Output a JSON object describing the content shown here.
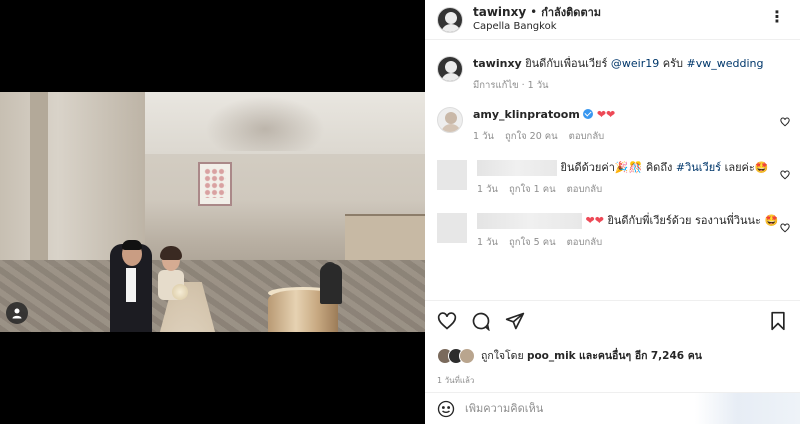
{
  "post": {
    "author": "tawinxy",
    "follow_status": "กำลังติดตาม",
    "location": "Capella Bangkok",
    "caption_text": "ยินดีกับเพื่อนเวียร์",
    "caption_mention": "@weir19",
    "caption_polite": "ครับ",
    "caption_hashtag": "#vw_wedding",
    "caption_meta": "มีการแก้ไข · 1 วัน"
  },
  "comments": [
    {
      "user": "amy_klinpratoom",
      "text": "❤❤",
      "time": "1 วัน",
      "likes": "ถูกใจ 20 คน",
      "reply": "ตอบกลับ"
    },
    {
      "user": "",
      "text_1": "ยินดีด้วยค่า🎉🎊",
      "text_2": "คิดถึง",
      "hashtag": "#วินเวียร์",
      "text_3": "เลยค่ะ🤩",
      "time": "1 วัน",
      "likes": "ถูกใจ 1 คน",
      "reply": "ตอบกลับ"
    },
    {
      "user": "",
      "hearts": "❤❤",
      "text": "ยินดีกับพี่เวียร์ด้วย รองานพี่วินนะ 🤩",
      "time": "1 วัน",
      "likes": "ถูกใจ 5 คน",
      "reply": "ตอบกลับ"
    }
  ],
  "actions": {
    "liked_by_prefix": "ถูกใจโดย",
    "liked_by_user": "poo_mik",
    "liked_by_suffix": "และคนอื่นๆ อีก",
    "liked_count": "7,246 คน",
    "posted_time": "1 วันที่แล้ว"
  },
  "add_comment": {
    "placeholder": "เพิ่มความคิดเห็น"
  },
  "colors": {
    "link": "#00376b",
    "heart": "#ed4956",
    "verified": "#3897f0",
    "muted": "#8e8e8e"
  },
  "icons": [
    "more-icon",
    "heart-icon",
    "comment-icon",
    "share-icon",
    "bookmark-icon",
    "emoji-icon",
    "verified-icon",
    "user-tag-icon"
  ]
}
